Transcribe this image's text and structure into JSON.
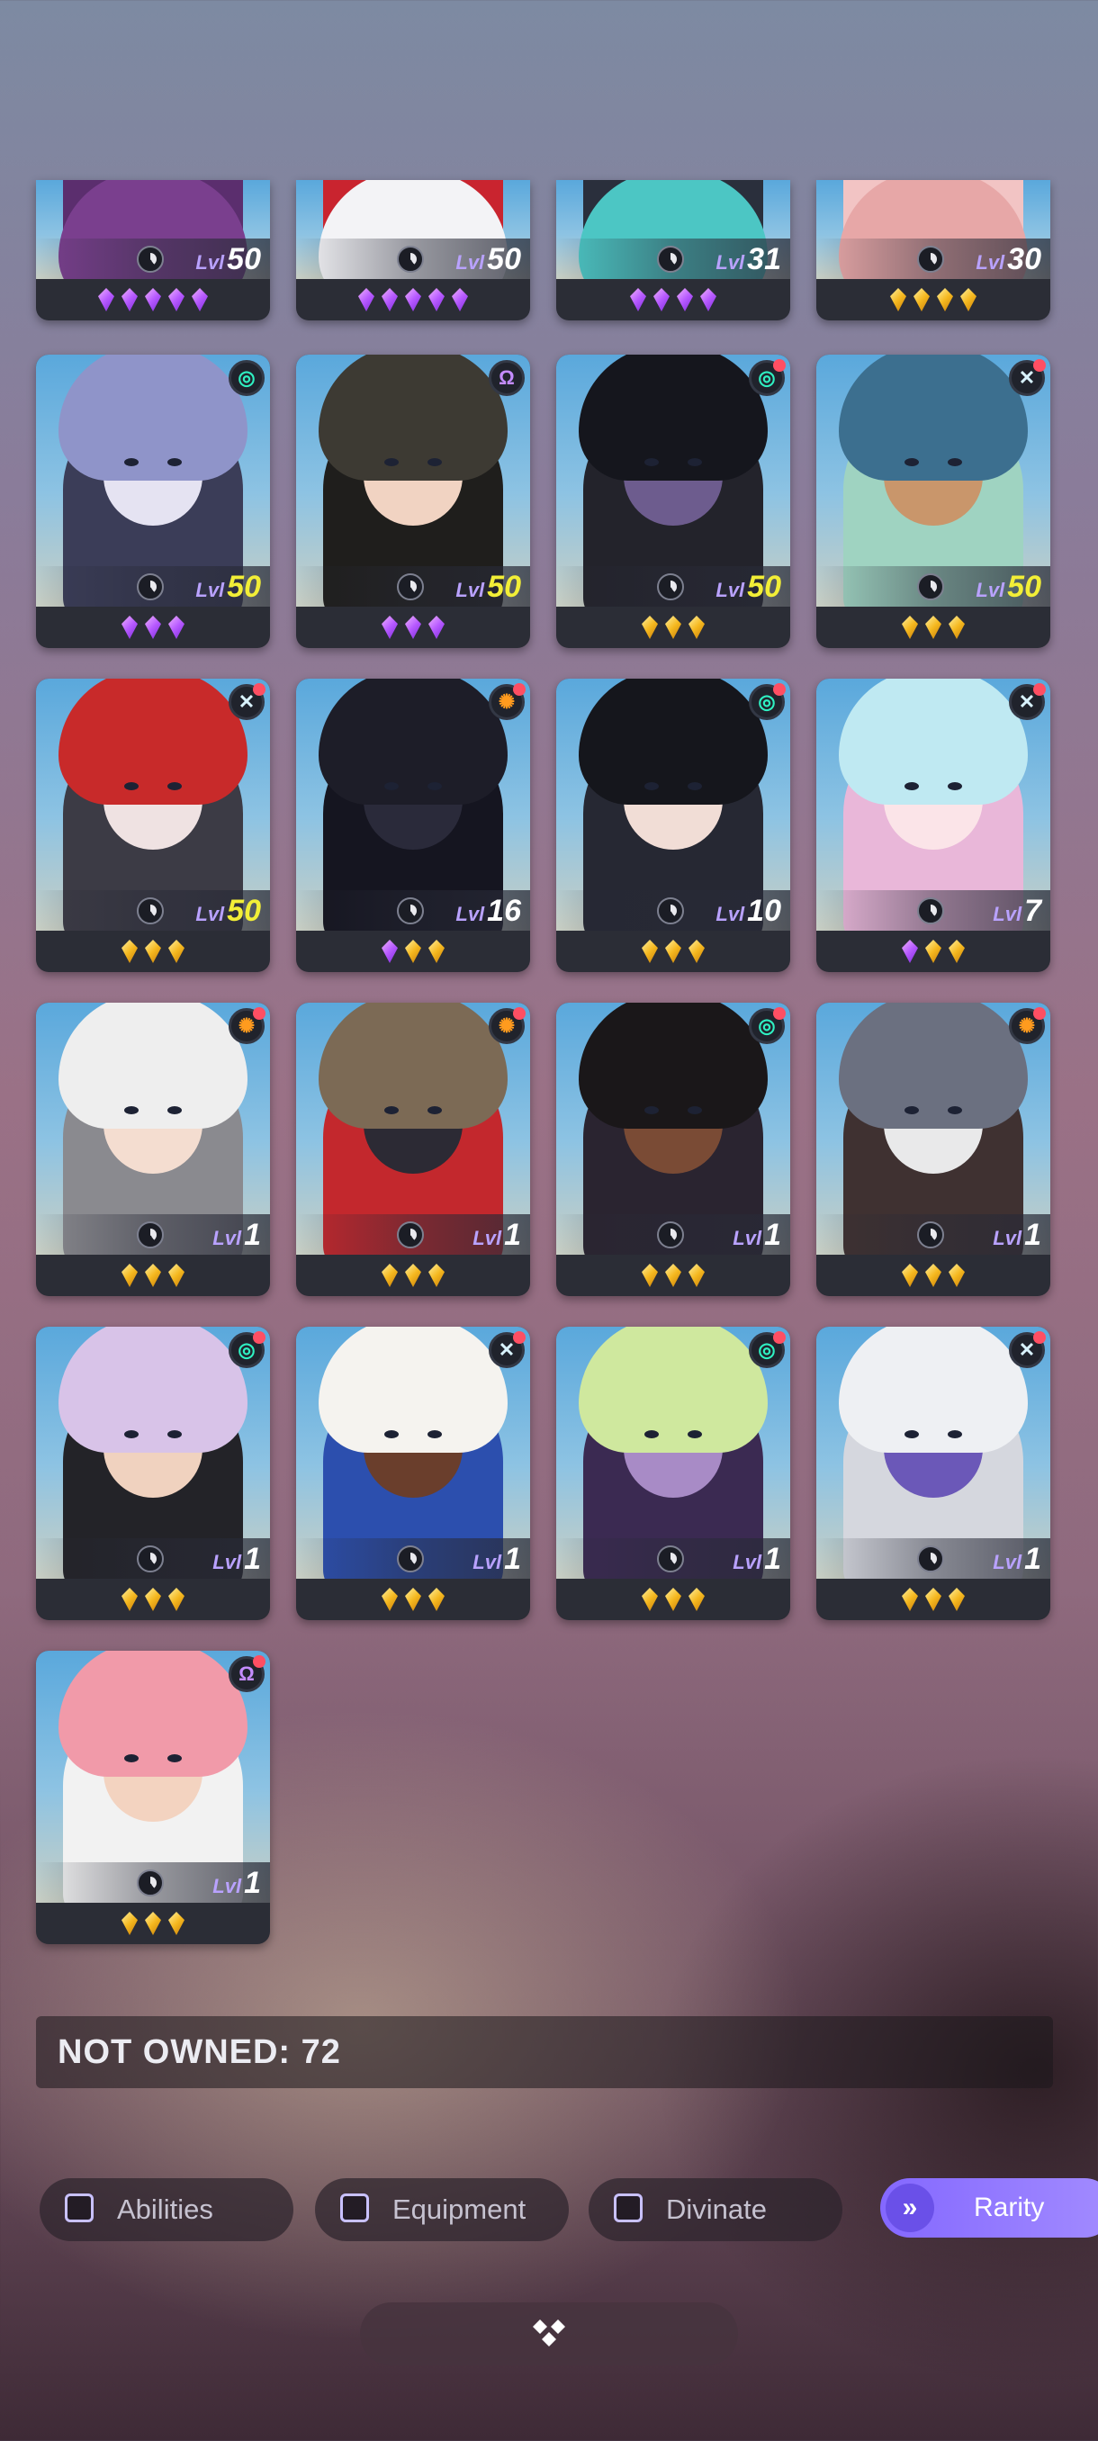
{
  "cards": [
    {
      "level": "50",
      "lvl_label": "Lvl",
      "lvl_color": "white",
      "gems": [
        "purple",
        "purple",
        "purple",
        "purple",
        "purple"
      ],
      "badge": null,
      "partial": true,
      "palette": {
        "hair": "#7a3f8e",
        "skin": "#f3d3c6",
        "outfit": "#5b2e6e"
      }
    },
    {
      "level": "50",
      "lvl_label": "Lvl",
      "lvl_color": "white",
      "gems": [
        "purple",
        "purple",
        "purple",
        "purple",
        "purple"
      ],
      "badge": null,
      "partial": true,
      "palette": {
        "hair": "#f3f3f6",
        "skin": "#f0dcd2",
        "outfit": "#c9242f"
      }
    },
    {
      "level": "31",
      "lvl_label": "Lvl",
      "lvl_color": "white",
      "gems": [
        "purple",
        "purple",
        "purple",
        "purple"
      ],
      "badge": null,
      "partial": true,
      "palette": {
        "hair": "#4cc6c4",
        "skin": "#7a4b3f",
        "outfit": "#2a2f3c"
      }
    },
    {
      "level": "30",
      "lvl_label": "Lvl",
      "lvl_color": "white",
      "gems": [
        "gold",
        "gold",
        "gold",
        "gold"
      ],
      "badge": null,
      "partial": true,
      "palette": {
        "hair": "#e7a7a7",
        "skin": "#f6d2c8",
        "outfit": "#f2c4c4"
      }
    },
    {
      "level": "50",
      "lvl_label": "Lvl",
      "lvl_color": "gold",
      "gems": [
        "purple",
        "purple",
        "purple"
      ],
      "badge": {
        "icon": "spiral-icon",
        "glyph": "◎",
        "color": "teal",
        "alert": false
      },
      "partial": false,
      "palette": {
        "hair": "#8f94c9",
        "skin": "#e5e3f2",
        "outfit": "#3b3d58"
      }
    },
    {
      "level": "50",
      "lvl_label": "Lvl",
      "lvl_color": "gold",
      "gems": [
        "purple",
        "purple",
        "purple"
      ],
      "badge": {
        "icon": "omega-icon",
        "glyph": "Ω",
        "color": "purple",
        "alert": false
      },
      "partial": false,
      "palette": {
        "hair": "#3d3a33",
        "skin": "#f1d3c2",
        "outfit": "#1f1e1c"
      }
    },
    {
      "level": "50",
      "lvl_label": "Lvl",
      "lvl_color": "gold",
      "gems": [
        "gold",
        "gold",
        "gold"
      ],
      "badge": {
        "icon": "spiral-icon",
        "glyph": "◎",
        "color": "teal",
        "alert": true
      },
      "partial": false,
      "palette": {
        "hair": "#15161d",
        "skin": "#6d5c8e",
        "outfit": "#23232b"
      }
    },
    {
      "level": "50",
      "lvl_label": "Lvl",
      "lvl_color": "gold",
      "gems": [
        "gold",
        "gold",
        "gold"
      ],
      "badge": {
        "icon": "cross-icon",
        "glyph": "✕",
        "color": "cross",
        "alert": true
      },
      "partial": false,
      "palette": {
        "hair": "#3c6f8f",
        "skin": "#c9966b",
        "outfit": "#9fd3c1"
      }
    },
    {
      "level": "50",
      "lvl_label": "Lvl",
      "lvl_color": "gold",
      "gems": [
        "gold",
        "gold",
        "gold"
      ],
      "badge": {
        "icon": "cross-icon",
        "glyph": "✕",
        "color": "cross",
        "alert": true
      },
      "partial": false,
      "palette": {
        "hair": "#c82a2a",
        "skin": "#efe2e2",
        "outfit": "#3c3b45"
      }
    },
    {
      "level": "16",
      "lvl_label": "Lvl",
      "lvl_color": "white",
      "gems": [
        "purple",
        "gold",
        "gold"
      ],
      "badge": {
        "icon": "gear-icon",
        "glyph": "✺",
        "color": "orange",
        "alert": true
      },
      "partial": false,
      "palette": {
        "hair": "#1d1d28",
        "skin": "#2a2a3a",
        "outfit": "#151520"
      }
    },
    {
      "level": "10",
      "lvl_label": "Lvl",
      "lvl_color": "white",
      "gems": [
        "gold",
        "gold",
        "gold"
      ],
      "badge": {
        "icon": "spiral-icon",
        "glyph": "◎",
        "color": "teal",
        "alert": true
      },
      "partial": false,
      "palette": {
        "hair": "#15161c",
        "skin": "#f1ddd6",
        "outfit": "#262833"
      }
    },
    {
      "level": "7",
      "lvl_label": "Lvl",
      "lvl_color": "white",
      "gems": [
        "purple",
        "gold",
        "gold"
      ],
      "badge": {
        "icon": "cross-icon",
        "glyph": "✕",
        "color": "cross",
        "alert": true
      },
      "partial": false,
      "palette": {
        "hair": "#bfe9f2",
        "skin": "#fbe4e8",
        "outfit": "#e9b7d9"
      }
    },
    {
      "level": "1",
      "lvl_label": "Lvl",
      "lvl_color": "white",
      "gems": [
        "gold",
        "gold",
        "gold"
      ],
      "badge": {
        "icon": "gear-icon",
        "glyph": "✺",
        "color": "orange",
        "alert": true
      },
      "partial": false,
      "palette": {
        "hair": "#eeeeee",
        "skin": "#f4ddd0",
        "outfit": "#8a8a8f"
      }
    },
    {
      "level": "1",
      "lvl_label": "Lvl",
      "lvl_color": "white",
      "gems": [
        "gold",
        "gold",
        "gold"
      ],
      "badge": {
        "icon": "gear-icon",
        "glyph": "✺",
        "color": "orange",
        "alert": true
      },
      "partial": false,
      "palette": {
        "hair": "#7c6a55",
        "skin": "#2c2a34",
        "outfit": "#c3282d"
      }
    },
    {
      "level": "1",
      "lvl_label": "Lvl",
      "lvl_color": "white",
      "gems": [
        "gold",
        "gold",
        "gold"
      ],
      "badge": {
        "icon": "spiral-icon",
        "glyph": "◎",
        "color": "teal",
        "alert": true
      },
      "partial": false,
      "palette": {
        "hair": "#1a1719",
        "skin": "#7a4b35",
        "outfit": "#2a2430"
      }
    },
    {
      "level": "1",
      "lvl_label": "Lvl",
      "lvl_color": "white",
      "gems": [
        "gold",
        "gold",
        "gold"
      ],
      "badge": {
        "icon": "gear-icon",
        "glyph": "✺",
        "color": "orange",
        "alert": true
      },
      "partial": false,
      "palette": {
        "hair": "#6b7080",
        "skin": "#e9e9ea",
        "outfit": "#3f3131"
      }
    },
    {
      "level": "1",
      "lvl_label": "Lvl",
      "lvl_color": "white",
      "gems": [
        "gold",
        "gold",
        "gold"
      ],
      "badge": {
        "icon": "spiral-icon",
        "glyph": "◎",
        "color": "teal",
        "alert": true
      },
      "partial": false,
      "palette": {
        "hair": "#d8c3e8",
        "skin": "#f0d2bf",
        "outfit": "#232328"
      }
    },
    {
      "level": "1",
      "lvl_label": "Lvl",
      "lvl_color": "white",
      "gems": [
        "gold",
        "gold",
        "gold"
      ],
      "badge": {
        "icon": "cross-icon",
        "glyph": "✕",
        "color": "cross",
        "alert": true
      },
      "partial": false,
      "palette": {
        "hair": "#f5f3ef",
        "skin": "#6a3e2c",
        "outfit": "#2c4fae"
      }
    },
    {
      "level": "1",
      "lvl_label": "Lvl",
      "lvl_color": "white",
      "gems": [
        "gold",
        "gold",
        "gold"
      ],
      "badge": {
        "icon": "spiral-icon",
        "glyph": "◎",
        "color": "teal",
        "alert": true
      },
      "partial": false,
      "palette": {
        "hair": "#cfe89e",
        "skin": "#a88bc6",
        "outfit": "#3b2a52"
      }
    },
    {
      "level": "1",
      "lvl_label": "Lvl",
      "lvl_color": "white",
      "gems": [
        "gold",
        "gold",
        "gold"
      ],
      "badge": {
        "icon": "cross-icon",
        "glyph": "✕",
        "color": "cross",
        "alert": true
      },
      "partial": false,
      "palette": {
        "hair": "#eef0f3",
        "skin": "#6b58b8",
        "outfit": "#d5d7de"
      }
    },
    {
      "level": "1",
      "lvl_label": "Lvl",
      "lvl_color": "white",
      "gems": [
        "gold",
        "gold",
        "gold"
      ],
      "badge": {
        "icon": "omega-icon",
        "glyph": "Ω",
        "color": "purple",
        "alert": true
      },
      "partial": false,
      "palette": {
        "hair": "#f19aa9",
        "skin": "#f3d3c0",
        "outfit": "#f2f2f2"
      }
    }
  ],
  "not_owned_label": "NOT OWNED: 72",
  "filters": [
    {
      "label": "Abilities"
    },
    {
      "label": "Equipment"
    },
    {
      "label": "Divinate"
    }
  ],
  "sort_button": {
    "label": "Rarity",
    "icon": "double-chevron-down-icon"
  },
  "collapse_button": {
    "icon": "collapse-diamonds-icon"
  }
}
